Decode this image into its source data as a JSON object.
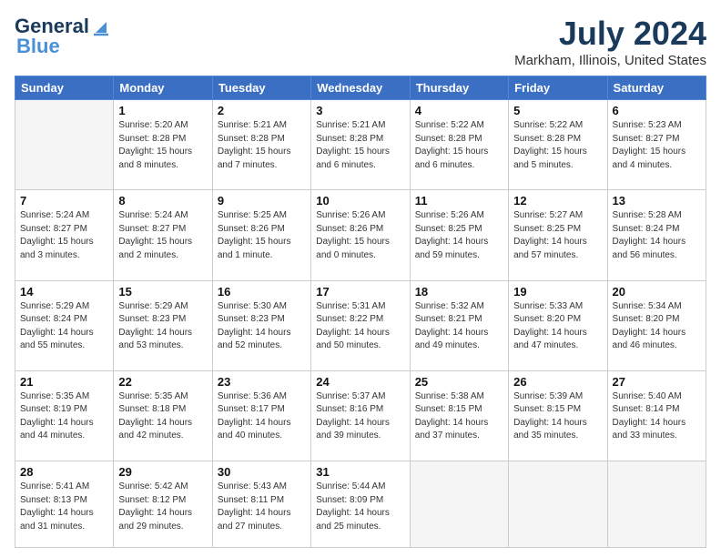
{
  "logo": {
    "line1": "General",
    "line2": "Blue"
  },
  "title": "July 2024",
  "subtitle": "Markham, Illinois, United States",
  "weekdays": [
    "Sunday",
    "Monday",
    "Tuesday",
    "Wednesday",
    "Thursday",
    "Friday",
    "Saturday"
  ],
  "weeks": [
    [
      {
        "day": "",
        "info": ""
      },
      {
        "day": "1",
        "info": "Sunrise: 5:20 AM\nSunset: 8:28 PM\nDaylight: 15 hours\nand 8 minutes."
      },
      {
        "day": "2",
        "info": "Sunrise: 5:21 AM\nSunset: 8:28 PM\nDaylight: 15 hours\nand 7 minutes."
      },
      {
        "day": "3",
        "info": "Sunrise: 5:21 AM\nSunset: 8:28 PM\nDaylight: 15 hours\nand 6 minutes."
      },
      {
        "day": "4",
        "info": "Sunrise: 5:22 AM\nSunset: 8:28 PM\nDaylight: 15 hours\nand 6 minutes."
      },
      {
        "day": "5",
        "info": "Sunrise: 5:22 AM\nSunset: 8:28 PM\nDaylight: 15 hours\nand 5 minutes."
      },
      {
        "day": "6",
        "info": "Sunrise: 5:23 AM\nSunset: 8:27 PM\nDaylight: 15 hours\nand 4 minutes."
      }
    ],
    [
      {
        "day": "7",
        "info": "Sunrise: 5:24 AM\nSunset: 8:27 PM\nDaylight: 15 hours\nand 3 minutes."
      },
      {
        "day": "8",
        "info": "Sunrise: 5:24 AM\nSunset: 8:27 PM\nDaylight: 15 hours\nand 2 minutes."
      },
      {
        "day": "9",
        "info": "Sunrise: 5:25 AM\nSunset: 8:26 PM\nDaylight: 15 hours\nand 1 minute."
      },
      {
        "day": "10",
        "info": "Sunrise: 5:26 AM\nSunset: 8:26 PM\nDaylight: 15 hours\nand 0 minutes."
      },
      {
        "day": "11",
        "info": "Sunrise: 5:26 AM\nSunset: 8:25 PM\nDaylight: 14 hours\nand 59 minutes."
      },
      {
        "day": "12",
        "info": "Sunrise: 5:27 AM\nSunset: 8:25 PM\nDaylight: 14 hours\nand 57 minutes."
      },
      {
        "day": "13",
        "info": "Sunrise: 5:28 AM\nSunset: 8:24 PM\nDaylight: 14 hours\nand 56 minutes."
      }
    ],
    [
      {
        "day": "14",
        "info": "Sunrise: 5:29 AM\nSunset: 8:24 PM\nDaylight: 14 hours\nand 55 minutes."
      },
      {
        "day": "15",
        "info": "Sunrise: 5:29 AM\nSunset: 8:23 PM\nDaylight: 14 hours\nand 53 minutes."
      },
      {
        "day": "16",
        "info": "Sunrise: 5:30 AM\nSunset: 8:23 PM\nDaylight: 14 hours\nand 52 minutes."
      },
      {
        "day": "17",
        "info": "Sunrise: 5:31 AM\nSunset: 8:22 PM\nDaylight: 14 hours\nand 50 minutes."
      },
      {
        "day": "18",
        "info": "Sunrise: 5:32 AM\nSunset: 8:21 PM\nDaylight: 14 hours\nand 49 minutes."
      },
      {
        "day": "19",
        "info": "Sunrise: 5:33 AM\nSunset: 8:20 PM\nDaylight: 14 hours\nand 47 minutes."
      },
      {
        "day": "20",
        "info": "Sunrise: 5:34 AM\nSunset: 8:20 PM\nDaylight: 14 hours\nand 46 minutes."
      }
    ],
    [
      {
        "day": "21",
        "info": "Sunrise: 5:35 AM\nSunset: 8:19 PM\nDaylight: 14 hours\nand 44 minutes."
      },
      {
        "day": "22",
        "info": "Sunrise: 5:35 AM\nSunset: 8:18 PM\nDaylight: 14 hours\nand 42 minutes."
      },
      {
        "day": "23",
        "info": "Sunrise: 5:36 AM\nSunset: 8:17 PM\nDaylight: 14 hours\nand 40 minutes."
      },
      {
        "day": "24",
        "info": "Sunrise: 5:37 AM\nSunset: 8:16 PM\nDaylight: 14 hours\nand 39 minutes."
      },
      {
        "day": "25",
        "info": "Sunrise: 5:38 AM\nSunset: 8:15 PM\nDaylight: 14 hours\nand 37 minutes."
      },
      {
        "day": "26",
        "info": "Sunrise: 5:39 AM\nSunset: 8:15 PM\nDaylight: 14 hours\nand 35 minutes."
      },
      {
        "day": "27",
        "info": "Sunrise: 5:40 AM\nSunset: 8:14 PM\nDaylight: 14 hours\nand 33 minutes."
      }
    ],
    [
      {
        "day": "28",
        "info": "Sunrise: 5:41 AM\nSunset: 8:13 PM\nDaylight: 14 hours\nand 31 minutes."
      },
      {
        "day": "29",
        "info": "Sunrise: 5:42 AM\nSunset: 8:12 PM\nDaylight: 14 hours\nand 29 minutes."
      },
      {
        "day": "30",
        "info": "Sunrise: 5:43 AM\nSunset: 8:11 PM\nDaylight: 14 hours\nand 27 minutes."
      },
      {
        "day": "31",
        "info": "Sunrise: 5:44 AM\nSunset: 8:09 PM\nDaylight: 14 hours\nand 25 minutes."
      },
      {
        "day": "",
        "info": ""
      },
      {
        "day": "",
        "info": ""
      },
      {
        "day": "",
        "info": ""
      }
    ]
  ]
}
